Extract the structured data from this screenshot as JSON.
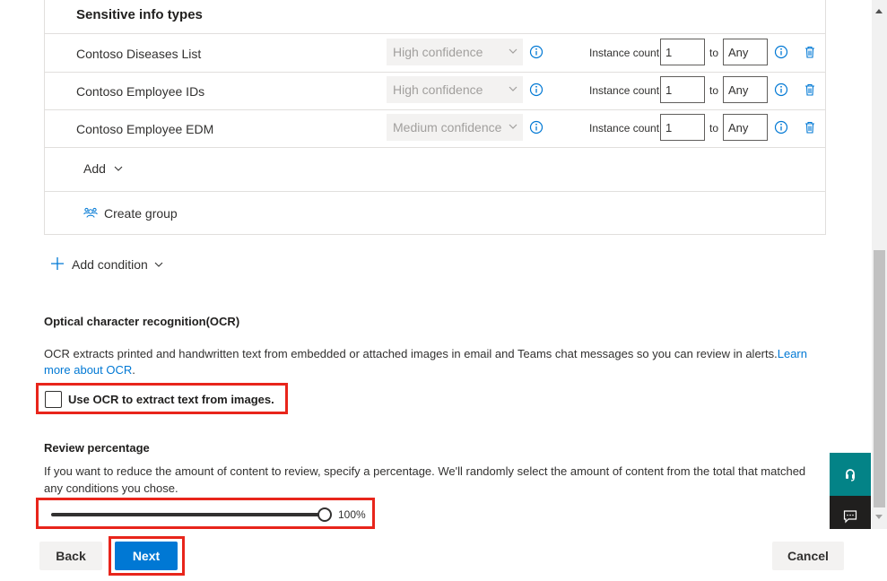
{
  "sensitive_info": {
    "header": "Sensitive info types",
    "rows": [
      {
        "name": "Contoso Diseases List",
        "confidence": "High confidence",
        "instance_label": "Instance count",
        "from": "1",
        "to_label": "to",
        "to": "Any"
      },
      {
        "name": "Contoso Employee IDs",
        "confidence": "High confidence",
        "instance_label": "Instance count",
        "from": "1",
        "to_label": "to",
        "to": "Any"
      },
      {
        "name": "Contoso Employee EDM",
        "confidence": "Medium confidence",
        "instance_label": "Instance count",
        "from": "1",
        "to_label": "to",
        "to": "Any"
      }
    ],
    "add_label": "Add",
    "create_group_label": "Create group"
  },
  "add_condition_label": "Add condition",
  "ocr": {
    "title": "Optical character recognition(OCR)",
    "description": "OCR extracts printed and handwritten text from embedded or attached images in email and Teams chat messages so you can review in alerts.",
    "learn_more": "Learn more about OCR",
    "period": ".",
    "checkbox_label": "Use OCR to extract text from images.",
    "checked": false
  },
  "review": {
    "title": "Review percentage",
    "description": "If you want to reduce the amount of content to review, specify a percentage. We'll randomly select the amount of content from the total that matched any conditions you chose.",
    "slider_value": "100%",
    "slider_fraction": 1.0
  },
  "footer": {
    "back_label": "Back",
    "next_label": "Next",
    "cancel_label": "Cancel"
  },
  "colors": {
    "accent": "#0078d4",
    "highlight": "#e8251b",
    "help_teal": "#038387"
  },
  "icons": [
    "info-icon",
    "trash-icon",
    "chevron-down-icon",
    "plus-icon",
    "group-icon",
    "help-icon",
    "feedback-icon"
  ]
}
